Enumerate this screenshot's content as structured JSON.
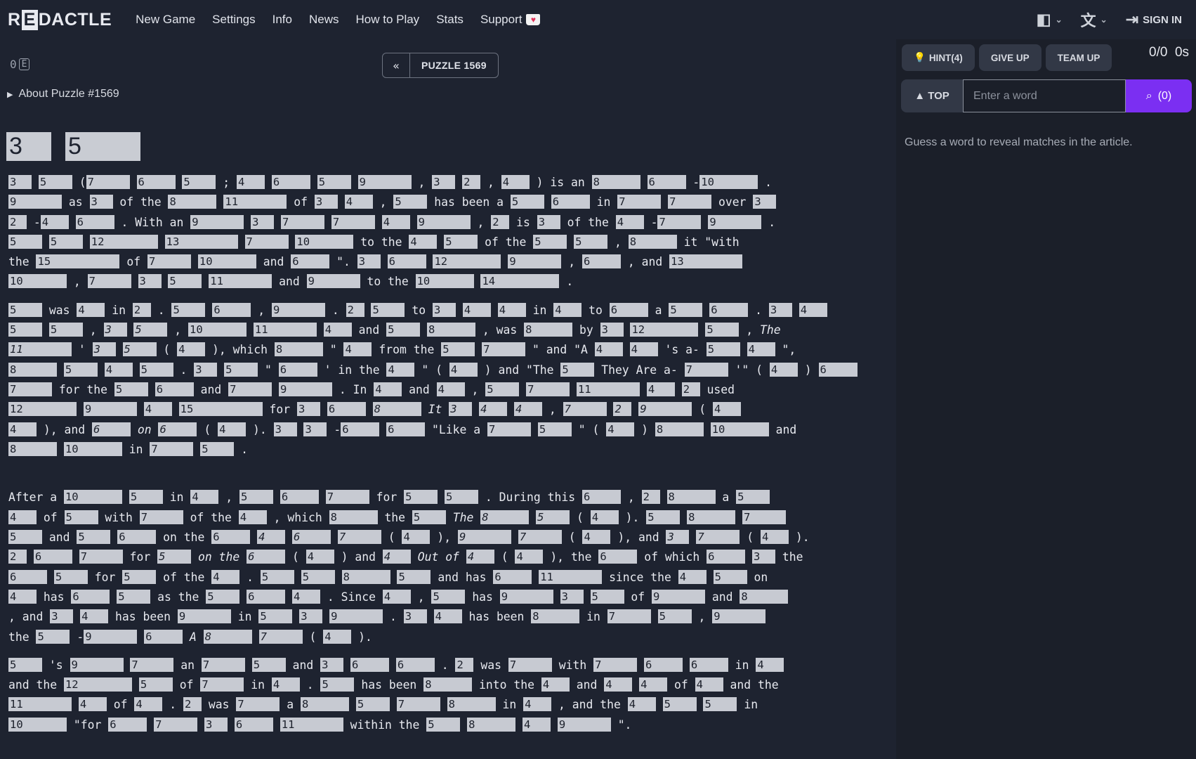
{
  "nav": {
    "logo_pre": "R",
    "logo_box": "E",
    "logo_post": "DACTLE",
    "items": [
      "New Game",
      "Settings",
      "Info",
      "News",
      "How to Play",
      "Stats",
      "Support"
    ],
    "sign_in": "SIGN IN",
    "icons": [
      "layout-icon",
      "translate-icon",
      "sign-in-icon",
      "heart-cup-icon"
    ]
  },
  "toolbar": {
    "redact_toggle_a": "0",
    "redact_toggle_b": "E",
    "prev": "«",
    "puzzle_title": "PUZZLE 1569",
    "about": "About Puzzle #1569"
  },
  "title_boxes": [
    "3",
    "5"
  ],
  "panel": {
    "hint": "HINT(4)",
    "give_up": "GIVE UP",
    "team_up": "TEAM UP",
    "score": "0/0  0s",
    "top": "▲ TOP",
    "placeholder": "Enter a word",
    "search_count": "(0)",
    "guess_text": "Guess a word to reveal matches in the article."
  },
  "colors": {
    "background": "#1e2330",
    "panel": "#1b1f29",
    "redaction": "#c7cad2",
    "accent": "#7b2ff2"
  }
}
